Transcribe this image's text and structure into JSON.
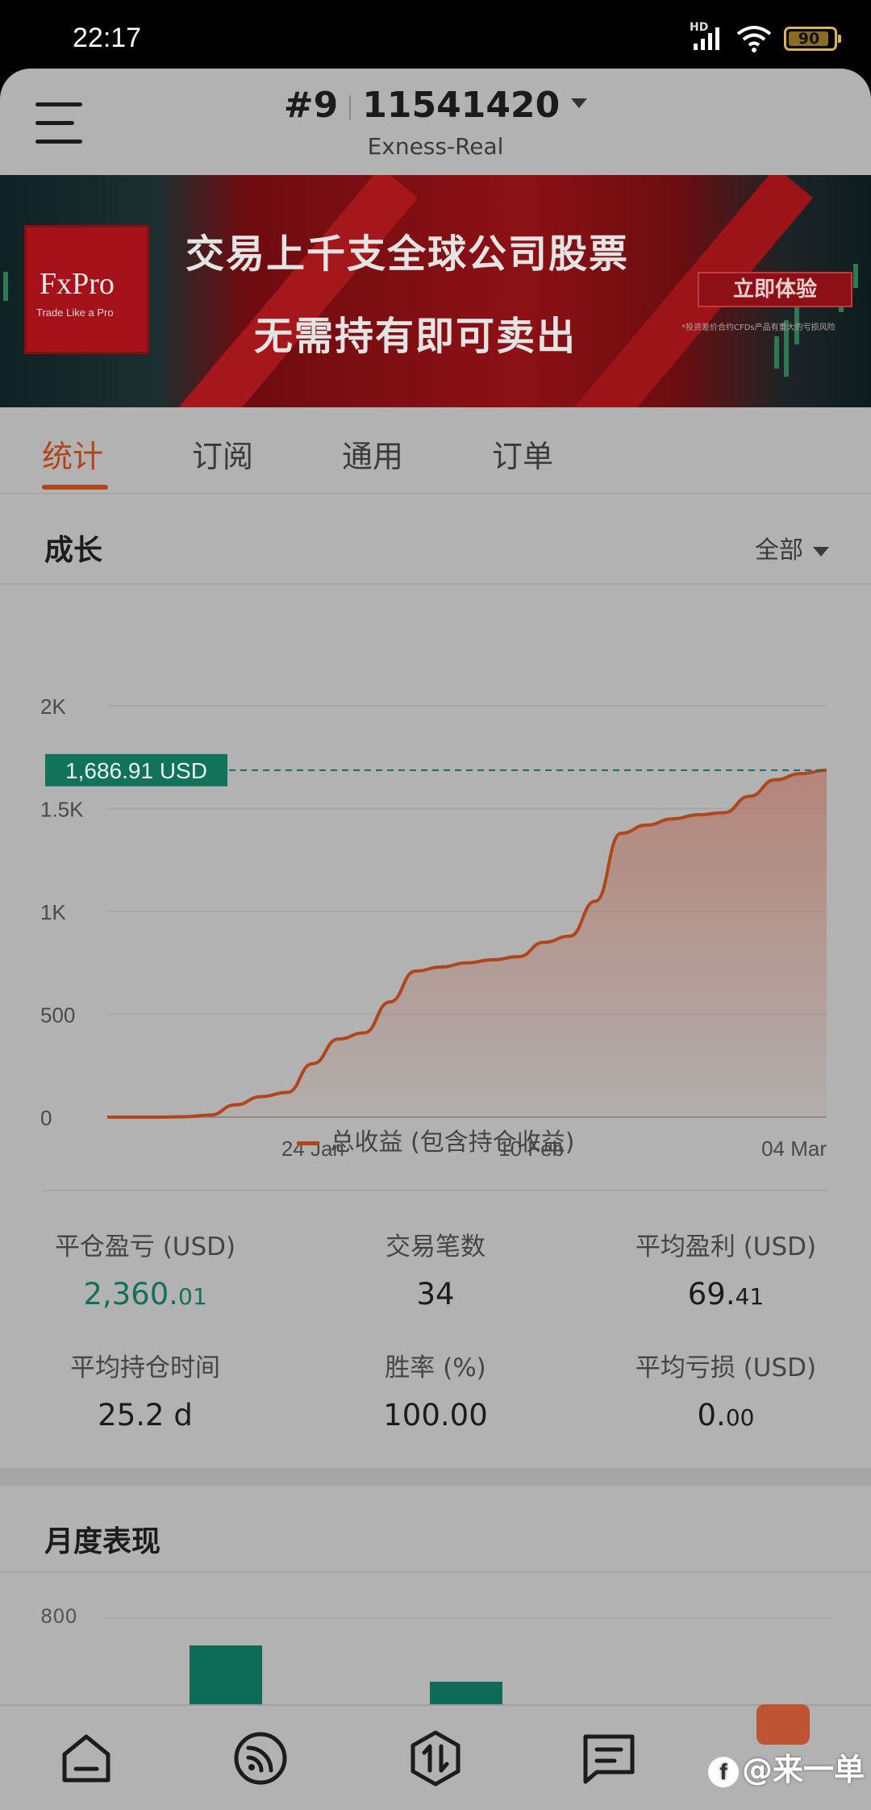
{
  "status": {
    "time": "22:17",
    "hd": "HD",
    "battery": "90"
  },
  "header": {
    "account_prefix": "#9",
    "account_number": "11541420",
    "server": "Exness-Real"
  },
  "banner": {
    "brand": "FxPro",
    "tagline": "Trade Like a Pro",
    "line1": "交易上千支全球公司股票",
    "line2": "无需持有即可卖出",
    "cta": "立即体验",
    "note": "*投资差价合约CFDs产品有重大的亏损风险"
  },
  "tabs": [
    "统计",
    "订阅",
    "通用",
    "订单"
  ],
  "growth": {
    "title": "成长",
    "range": "全部",
    "current_value_label": "1,686.91 USD",
    "legend": "总收益 (包含持仓收益)"
  },
  "chart_data": {
    "type": "area",
    "ylim": [
      0,
      2000
    ],
    "y_ticks": [
      "0",
      "500",
      "1K",
      "1.5K",
      "2K"
    ],
    "x_ticks": [
      "24 Jan",
      "10 Feb",
      "04 Mar"
    ],
    "x": [
      "2024-01-08",
      "2024-01-10",
      "2024-01-12",
      "2024-01-14",
      "2024-01-16",
      "2024-01-18",
      "2024-01-20",
      "2024-01-22",
      "2024-01-24",
      "2024-01-26",
      "2024-01-28",
      "2024-01-30",
      "2024-02-01",
      "2024-02-03",
      "2024-02-05",
      "2024-02-07",
      "2024-02-09",
      "2024-02-11",
      "2024-02-13",
      "2024-02-15",
      "2024-02-17",
      "2024-02-19",
      "2024-02-21",
      "2024-02-23",
      "2024-02-25",
      "2024-02-27",
      "2024-02-29",
      "2024-03-02",
      "2024-03-04"
    ],
    "series": [
      {
        "values": [
          0,
          0,
          0,
          2,
          10,
          60,
          100,
          120,
          260,
          380,
          410,
          560,
          710,
          730,
          750,
          765,
          780,
          850,
          880,
          1050,
          1380,
          1420,
          1450,
          1470,
          1480,
          1560,
          1640,
          1670,
          1686.91
        ]
      }
    ],
    "reference_line": 1686.91
  },
  "stats": [
    {
      "label": "平仓盈亏 (USD)",
      "value_main": "2,360.",
      "value_small": "01",
      "color": "green"
    },
    {
      "label": "交易笔数",
      "value_main": "34",
      "value_small": ""
    },
    {
      "label": "平均盈利 (USD)",
      "value_main": "69.",
      "value_small": "41"
    },
    {
      "label": "平均持仓时间",
      "value_main": "25.2 d",
      "value_small": ""
    },
    {
      "label": "胜率 (%)",
      "value_main": "100.00",
      "value_small": ""
    },
    {
      "label": "平均亏损 (USD)",
      "value_main": "0.",
      "value_small": "00"
    }
  ],
  "monthly": {
    "title": "月度表现",
    "y_label": "800"
  },
  "nav": {
    "items": [
      "home-icon",
      "feed-icon",
      "trade-icon",
      "messages-icon"
    ],
    "watermark": "@来一单"
  }
}
